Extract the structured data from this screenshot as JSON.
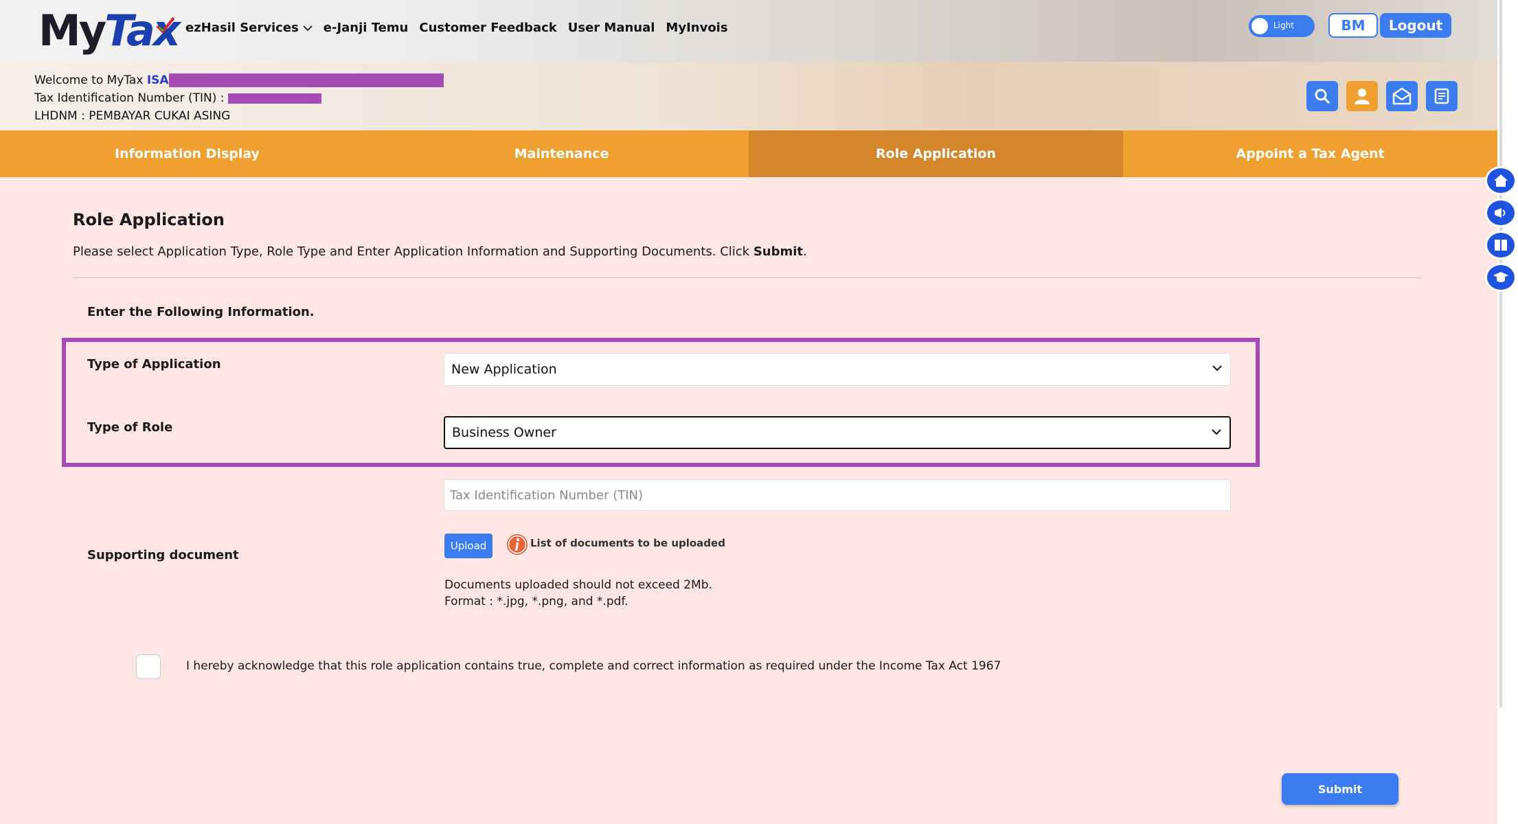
{
  "app": {
    "logo_my": "My",
    "logo_tax": "Tax"
  },
  "nav": {
    "items": [
      "ezHasil Services",
      "e-Janji Temu",
      "Customer Feedback",
      "User Manual",
      "MyInvois"
    ]
  },
  "header": {
    "theme_toggle_label": "Light",
    "lang_button": "BM",
    "logout_button": "Logout"
  },
  "welcome": {
    "greeting": "Welcome to MyTax ",
    "name_visible": "ISA",
    "tin_label": "Tax Identification Number (TIN) :",
    "office": "LHDNM : PEMBAYAR CUKAI ASING"
  },
  "tabs": [
    {
      "label": "Information Display",
      "active": false
    },
    {
      "label": "Maintenance",
      "active": false
    },
    {
      "label": "Role Application",
      "active": true
    },
    {
      "label": "Appoint a Tax Agent",
      "active": false
    }
  ],
  "form": {
    "title": "Role Application",
    "instruction_prefix": "Please select Application Type, Role Type and Enter Application Information and Supporting Documents. Click ",
    "instruction_bold": "Submit",
    "instruction_suffix": ".",
    "section_heading": "Enter the Following Information.",
    "type_of_application_label": "Type of Application",
    "type_of_application_value": "New Application",
    "type_of_role_label": "Type of Role",
    "type_of_role_value": "Business Owner",
    "tin_placeholder": "Tax Identification Number (TIN)",
    "supporting_document_label": "Supporting document",
    "upload_button": "Upload",
    "documents_list_link": "List of documents to be uploaded",
    "size_note": "Documents uploaded should not exceed 2Mb.",
    "format_note": "Format : *.jpg, *.png, and *.pdf.",
    "acknowledgement": "I hereby acknowledge that this role application contains true, complete and correct information as required under the Income Tax Act 1967",
    "submit_button": "Submit"
  },
  "colors": {
    "accent_blue": "#3b7cf0",
    "tab_orange": "#f0a030",
    "tab_active": "#d4872a",
    "highlight_purple": "#a64bb3",
    "content_bg": "#fde6e3"
  }
}
